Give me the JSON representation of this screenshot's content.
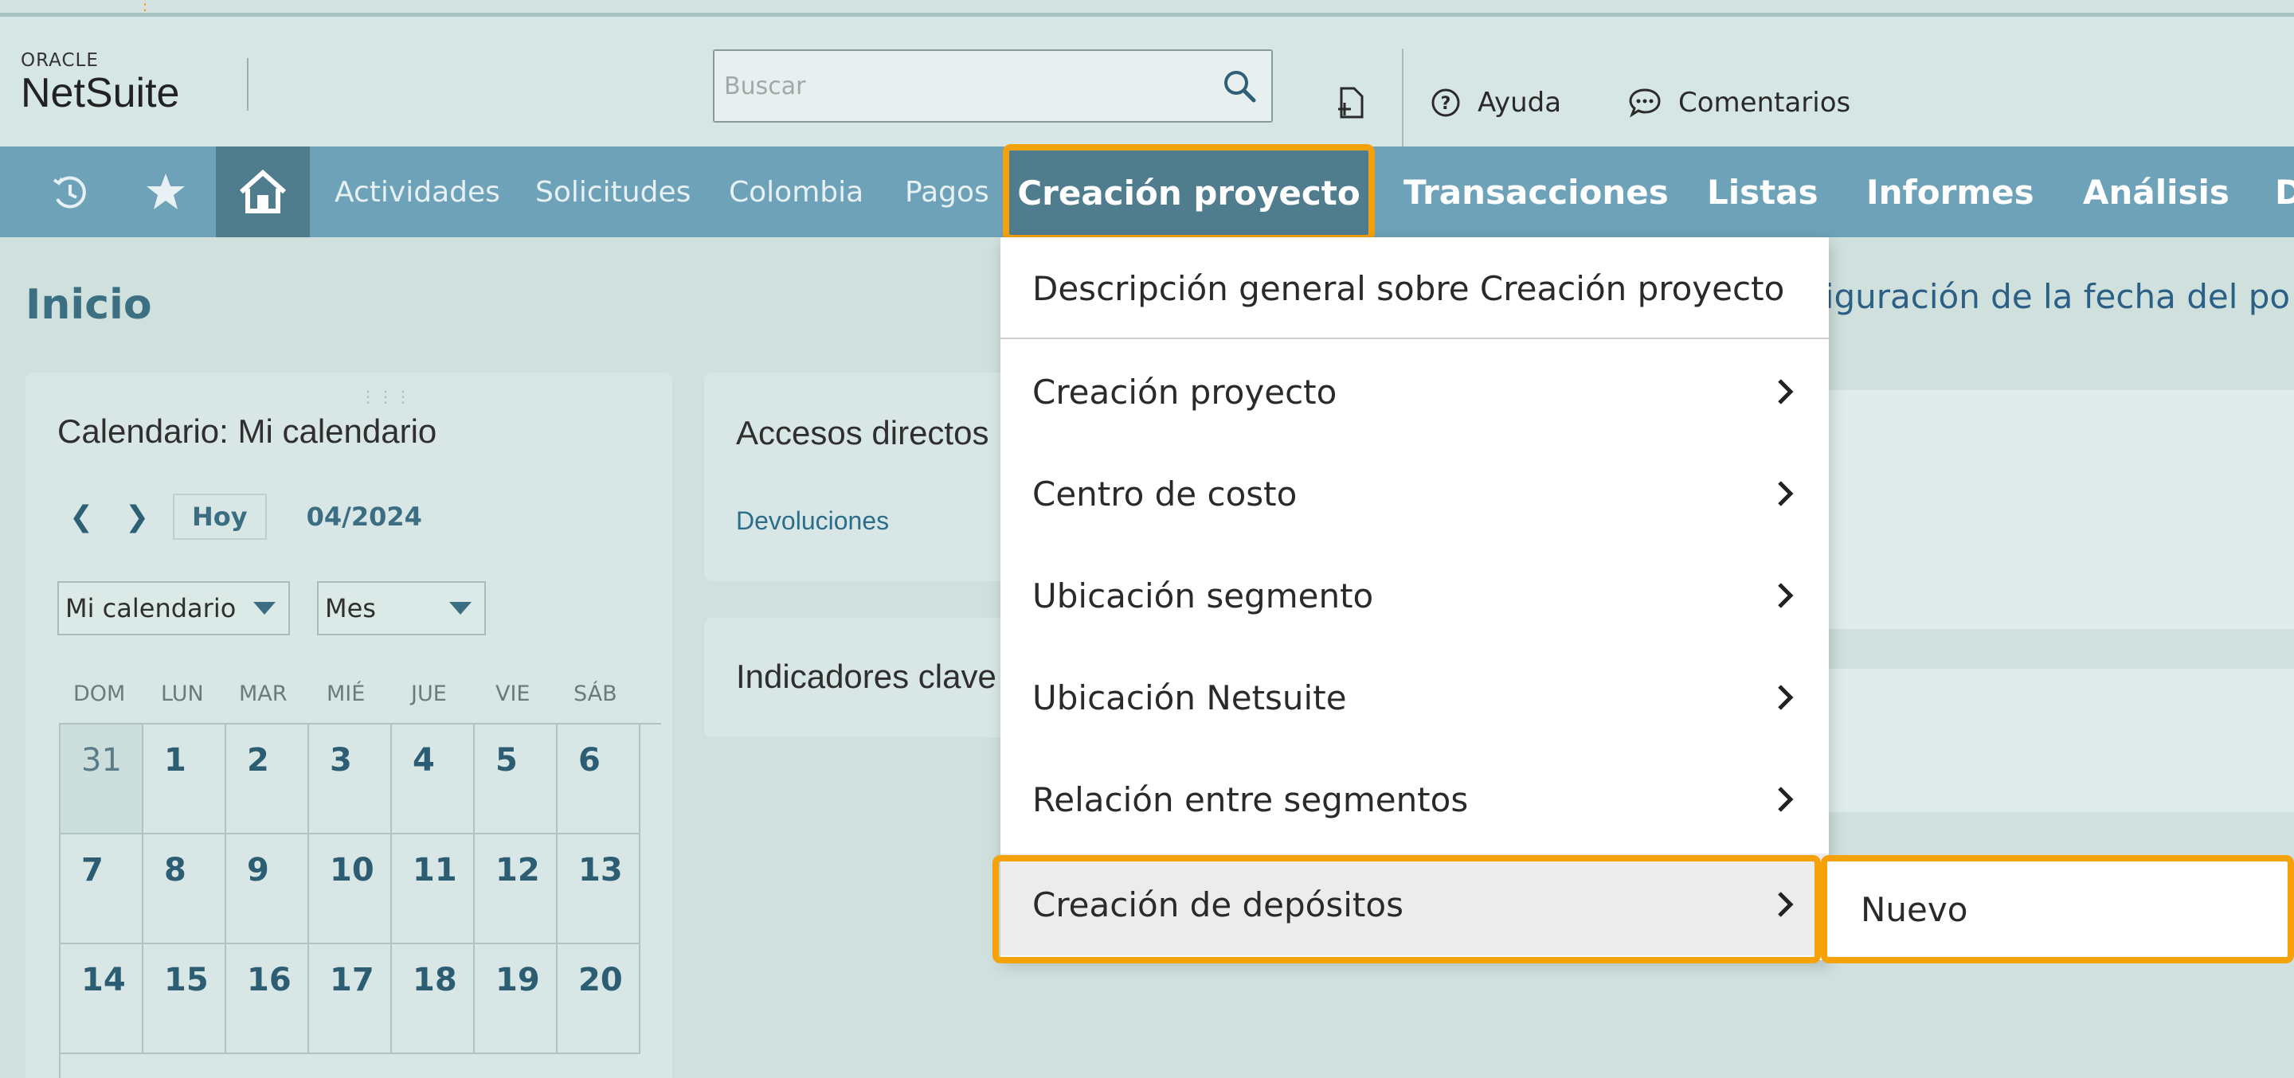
{
  "header": {
    "logo_oracle": "ORACLE",
    "logo_netsuite": "NetSuite",
    "search_placeholder": "Buscar",
    "help_label": "Ayuda",
    "feedback_label": "Comentarios"
  },
  "nav": {
    "items": [
      {
        "label": "Actividades"
      },
      {
        "label": "Solicitudes"
      },
      {
        "label": "Colombia"
      },
      {
        "label": "Pagos"
      },
      {
        "label": "Creación proyecto"
      },
      {
        "label": "Transacciones"
      },
      {
        "label": "Listas"
      },
      {
        "label": "Informes"
      },
      {
        "label": "Análisis"
      },
      {
        "label": "D"
      }
    ]
  },
  "page": {
    "title": "Inicio",
    "pref_text": "figuración de la fecha del po"
  },
  "calendar": {
    "title": "Calendario: Mi calendario",
    "today_label": "Hoy",
    "month_label": "04/2024",
    "calendar_select": "Mi calendario",
    "view_select": "Mes",
    "weekdays": [
      "DOM",
      "LUN",
      "MAR",
      "MIÉ",
      "JUE",
      "VIE",
      "SÁB"
    ],
    "weeks": [
      [
        "31",
        "1",
        "2",
        "3",
        "4",
        "5",
        "6"
      ],
      [
        "7",
        "8",
        "9",
        "10",
        "11",
        "12",
        "13"
      ],
      [
        "14",
        "15",
        "16",
        "17",
        "18",
        "19",
        "20"
      ]
    ]
  },
  "shortcuts": {
    "title": "Accesos directos",
    "link": "Devoluciones"
  },
  "kpi": {
    "title": "Indicadores clave"
  },
  "menu": {
    "overview": "Descripción general sobre Creación proyecto",
    "items": [
      {
        "label": "Creación proyecto"
      },
      {
        "label": "Centro de costo"
      },
      {
        "label": "Ubicación segmento"
      },
      {
        "label": "Ubicación Netsuite"
      },
      {
        "label": "Relación entre segmentos"
      },
      {
        "label": "Creación de depósitos"
      }
    ],
    "submenu_item": "Nuevo"
  }
}
